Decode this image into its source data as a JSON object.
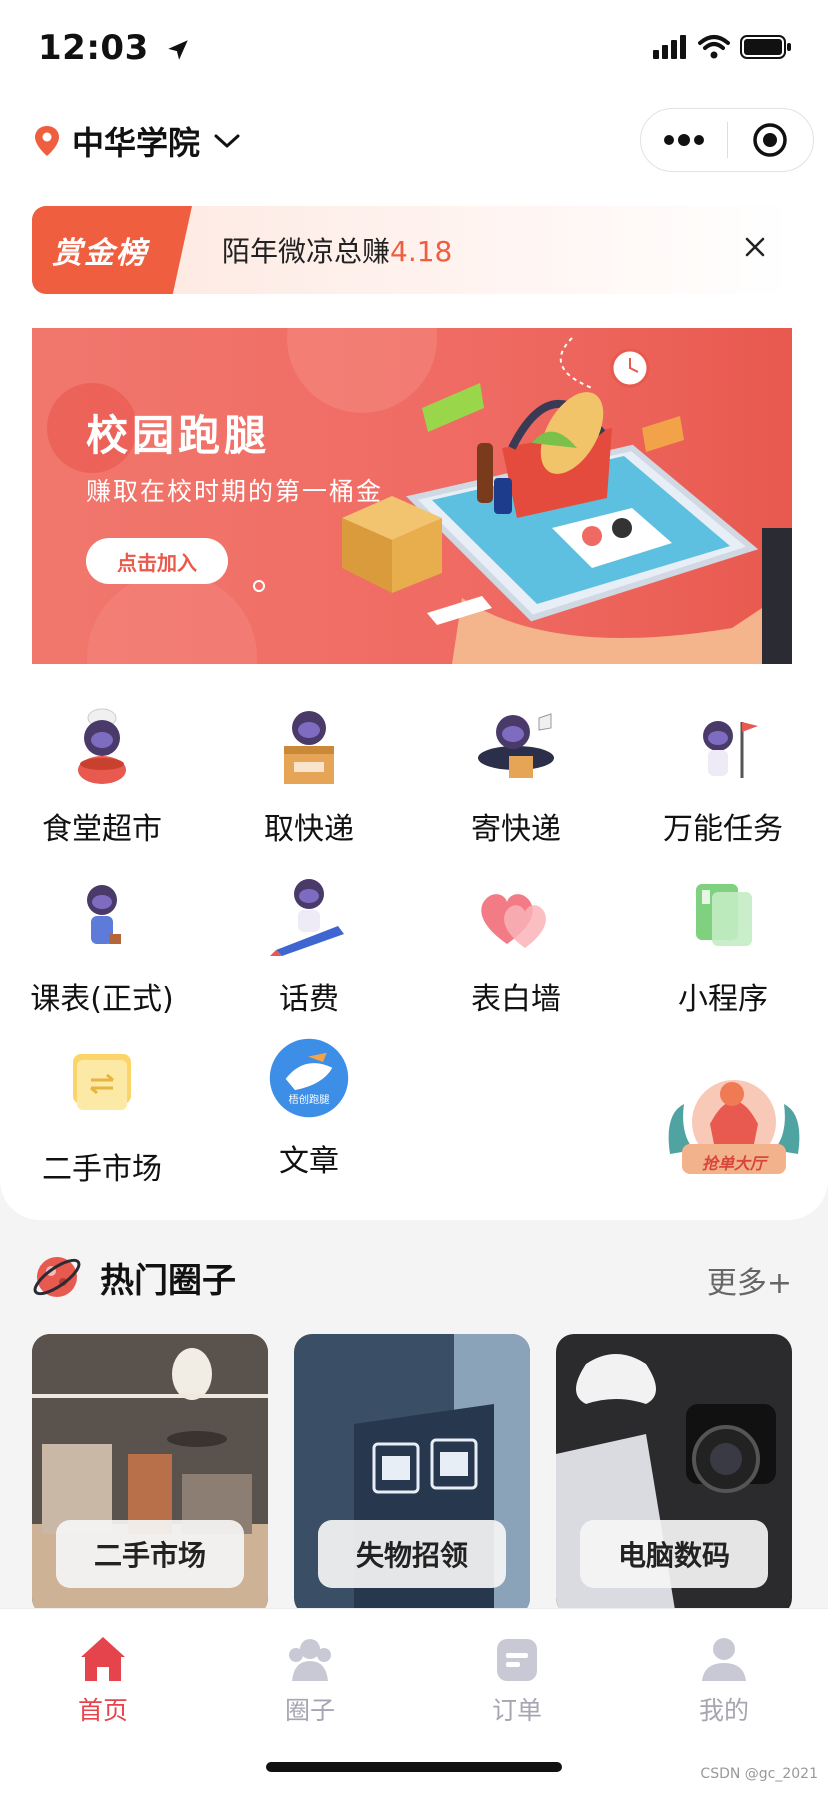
{
  "status_bar": {
    "time": "12:03"
  },
  "header": {
    "location": "中华学院"
  },
  "reward": {
    "tag": "赏金榜",
    "text": "陌年微凉总赚",
    "amount": "4.18"
  },
  "banner": {
    "title": "校园跑腿",
    "subtitle": "赚取在校时期的第一桶金",
    "button": "点击加入"
  },
  "services": [
    {
      "label": "食堂超市",
      "icon": "canteen-astronaut-icon"
    },
    {
      "label": "取快递",
      "icon": "pickup-package-icon"
    },
    {
      "label": "寄快递",
      "icon": "send-package-icon"
    },
    {
      "label": "万能任务",
      "icon": "task-flag-icon"
    },
    {
      "label": "课表(正式)",
      "icon": "schedule-astronaut-icon"
    },
    {
      "label": "话费",
      "icon": "phone-bill-icon"
    },
    {
      "label": "表白墙",
      "icon": "hearts-icon"
    },
    {
      "label": "小程序",
      "icon": "mini-program-icon"
    },
    {
      "label": "二手市场",
      "icon": "second-hand-icon"
    },
    {
      "label": "文章",
      "icon": "article-icon"
    }
  ],
  "floating_badge": {
    "label": "抢单大厅"
  },
  "article_badge_text": "梧创跑腿",
  "hot": {
    "title": "热门圈子",
    "more": "更多+",
    "cards": [
      {
        "label": "二手市场"
      },
      {
        "label": "失物招领"
      },
      {
        "label": "电脑数码"
      }
    ]
  },
  "tabbar": {
    "items": [
      {
        "label": "首页",
        "active": true
      },
      {
        "label": "圈子",
        "active": false
      },
      {
        "label": "订单",
        "active": false
      },
      {
        "label": "我的",
        "active": false
      }
    ]
  },
  "watermark": "CSDN @gc_2021",
  "colors": {
    "accent": "#e6444c",
    "brand_orange": "#ee5e3f",
    "inactive": "#a6a6b2"
  }
}
